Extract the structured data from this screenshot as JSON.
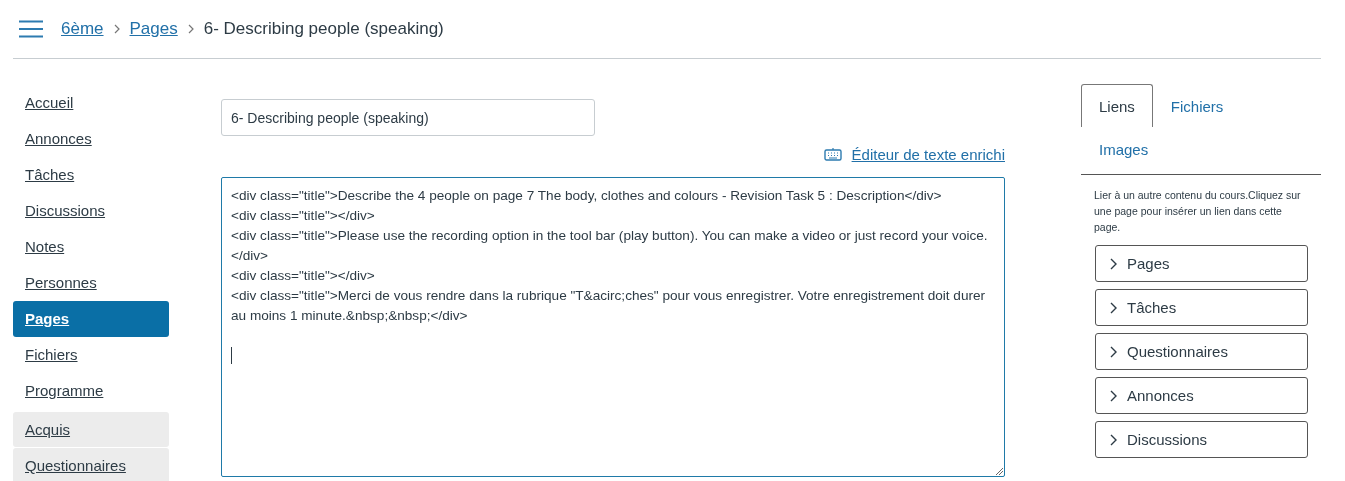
{
  "breadcrumb": [
    {
      "label": "6ème",
      "link": true
    },
    {
      "label": "Pages",
      "link": true
    },
    {
      "label": "6- Describing people (speaking)",
      "link": false
    }
  ],
  "sidebar": {
    "items": [
      {
        "label": "Accueil",
        "selected": false,
        "hidden": false
      },
      {
        "label": "Annonces",
        "selected": false,
        "hidden": false
      },
      {
        "label": "Tâches",
        "selected": false,
        "hidden": false
      },
      {
        "label": "Discussions",
        "selected": false,
        "hidden": false
      },
      {
        "label": "Notes",
        "selected": false,
        "hidden": false
      },
      {
        "label": "Personnes",
        "selected": false,
        "hidden": false
      },
      {
        "label": "Pages",
        "selected": true,
        "hidden": false
      },
      {
        "label": "Fichiers",
        "selected": false,
        "hidden": false
      },
      {
        "label": "Programme",
        "selected": false,
        "hidden": false
      },
      {
        "label": "Acquis",
        "selected": false,
        "hidden": true
      },
      {
        "label": "Questionnaires",
        "selected": false,
        "hidden": true
      }
    ]
  },
  "editor": {
    "title_value": "6- Describing people (speaking)",
    "rich_editor_link": "Éditeur de texte enrichi",
    "html_value": "<div class=\"title\">Describe the 4 people on page 7 The body, clothes and colours - Revision Task 5 : Description</div>\n<div class=\"title\"></div>\n<div class=\"title\">Please use the recording option in the tool bar (play button). You can make a video or just record your voice.</div>\n<div class=\"title\"></div>\n<div class=\"title\">Merci de vous rendre dans la rubrique \"T&acirc;ches\" pour vous enregistrer. Votre enregistrement doit durer au moins 1 minute.&nbsp;&nbsp;</div>\n\n"
  },
  "panel": {
    "tabs": [
      {
        "label": "Liens",
        "selected": true
      },
      {
        "label": "Fichiers",
        "selected": false
      },
      {
        "label": "Images",
        "selected": false
      }
    ],
    "description": "Lier à un autre contenu du cours.Cliquez sur une page pour insérer un lien dans cette page.",
    "sections": [
      {
        "label": "Pages",
        "expanded": false
      },
      {
        "label": "Tâches",
        "expanded": false
      },
      {
        "label": "Questionnaires",
        "expanded": false
      },
      {
        "label": "Annonces",
        "expanded": false
      },
      {
        "label": "Discussions",
        "expanded": false
      }
    ]
  }
}
